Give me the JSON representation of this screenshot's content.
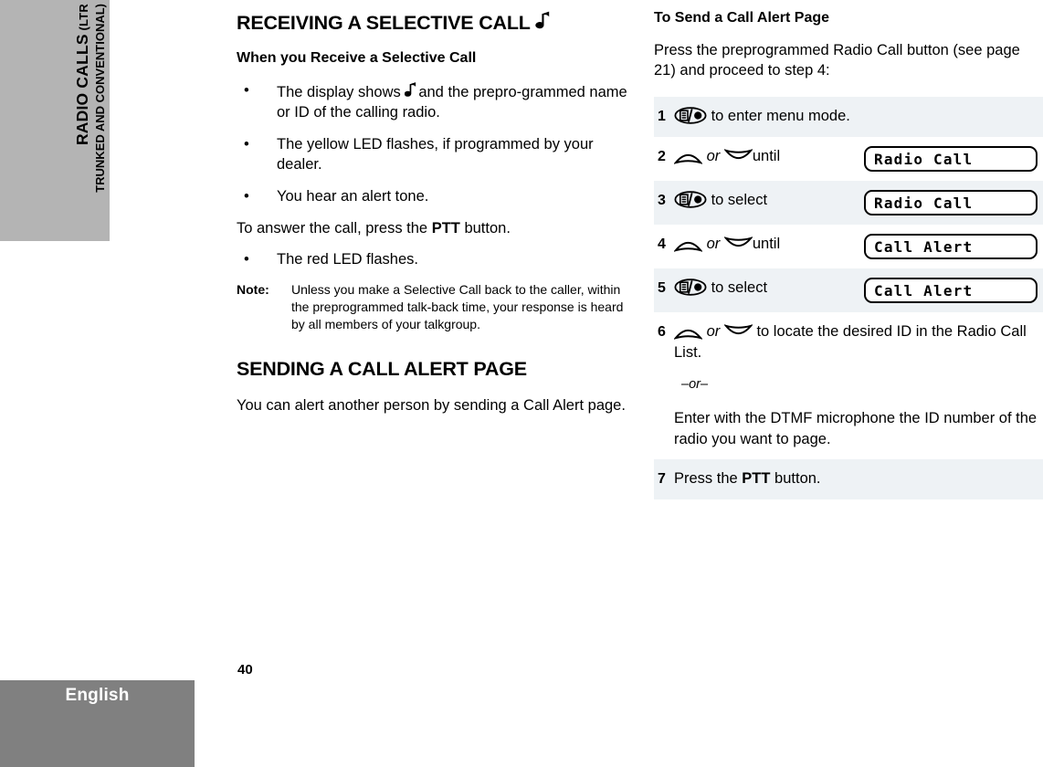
{
  "side_tab": {
    "chapter_main": "RADIO CALLS",
    "chapter_paren_open": " (LTR",
    "chapter_line2": "TRUNKED AND CONVENTIONAL)"
  },
  "footer": {
    "language": "English",
    "page_number": "40"
  },
  "left_column": {
    "section_title": "RECEIVING A SELECTIVE CALL",
    "section_title_icon": "musical-note-icon",
    "sub_title": "When you Receive a Selective Call",
    "bullets_1": [
      {
        "bullet": "•",
        "text_before": "The display shows",
        "icon": "musical-note-icon",
        "text_after": "and the prepro-grammed name or ID of the calling radio."
      },
      {
        "bullet": "•",
        "text": "The yellow LED flashes, if programmed by your dealer."
      },
      {
        "bullet": "•",
        "text": "You hear an alert tone."
      }
    ],
    "answer_text_before": "To answer the call, press the ",
    "answer_ptt": "PTT",
    "answer_text_after": " button.",
    "bullets_2": [
      {
        "bullet": "•",
        "text": "The red LED flashes."
      }
    ],
    "note_label": "Note:",
    "note_body": "Unless you make a Selective Call back to the caller, within the preprogrammed talk-back time, your response is heard by all members of your talkgroup.",
    "section_title_2": "SENDING A CALL ALERT PAGE",
    "paragraph_2": "You can alert another person by sending a Call Alert page."
  },
  "right_column": {
    "sub_title": "To Send a Call Alert Page",
    "intro": "Press the preprogrammed Radio Call button (see page 21) and proceed to step 4:",
    "steps": [
      {
        "number": "1",
        "shaded": true,
        "icons": [
          "menu-select-button-icon"
        ],
        "text_after": " to enter menu mode.",
        "display": null
      },
      {
        "number": "2",
        "shaded": false,
        "icons": [
          "arrow-up-icon",
          "arrow-down-icon"
        ],
        "connector": "or",
        "text_after": "until",
        "display": "Radio Call"
      },
      {
        "number": "3",
        "shaded": true,
        "icons": [
          "menu-select-button-icon"
        ],
        "text_after": " to select",
        "display": "Radio Call"
      },
      {
        "number": "4",
        "shaded": false,
        "icons": [
          "arrow-up-icon",
          "arrow-down-icon"
        ],
        "connector": "or",
        "text_after": "until",
        "display": "Call Alert"
      },
      {
        "number": "5",
        "shaded": true,
        "icons": [
          "menu-select-button-icon"
        ],
        "text_after": " to select",
        "display": "Call Alert"
      },
      {
        "number": "6",
        "shaded": false,
        "icons": [
          "arrow-up-icon",
          "arrow-down-icon"
        ],
        "connector": "or",
        "text_after": "to locate the desired ID in the Radio Call List.",
        "or_divider": "–or–",
        "alt_text": "Enter with the DTMF microphone the ID number of the radio you want to page.",
        "display": null
      },
      {
        "number": "7",
        "shaded": true,
        "text_before": "Press the ",
        "bold_word": "PTT",
        "text_after": " button.",
        "display": null
      }
    ]
  },
  "colors": {
    "side_tab_bg": "#b4b4b4",
    "footer_bg": "#808080",
    "row_shaded": "#eef2f5",
    "text": "#000000"
  }
}
